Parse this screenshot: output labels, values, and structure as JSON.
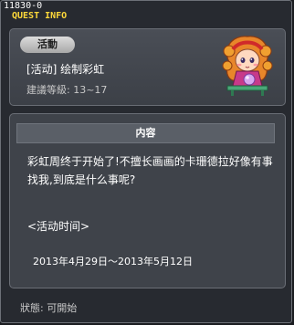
{
  "window": {
    "quest_id": "11830-0",
    "title": "QUEST INFO"
  },
  "header": {
    "category_badge": "活動",
    "quest_name": "[活动] 绘制彩虹",
    "level_label": "建議等級:",
    "level_range": "13~17"
  },
  "content": {
    "header": "内容",
    "description": "彩虹周终于开始了!不擅长画画的卡珊德拉好像有事找我,到底是什么事呢?",
    "event_time_label": "<活动时间>",
    "event_time_value": "2013年4月29日～2013年5月12日"
  },
  "status": {
    "label": "狀態:",
    "value": "可開始"
  },
  "icons": {
    "npc": "cassandra-npc-icon"
  },
  "colors": {
    "title": "#ffd93a",
    "background": "#272a30"
  }
}
